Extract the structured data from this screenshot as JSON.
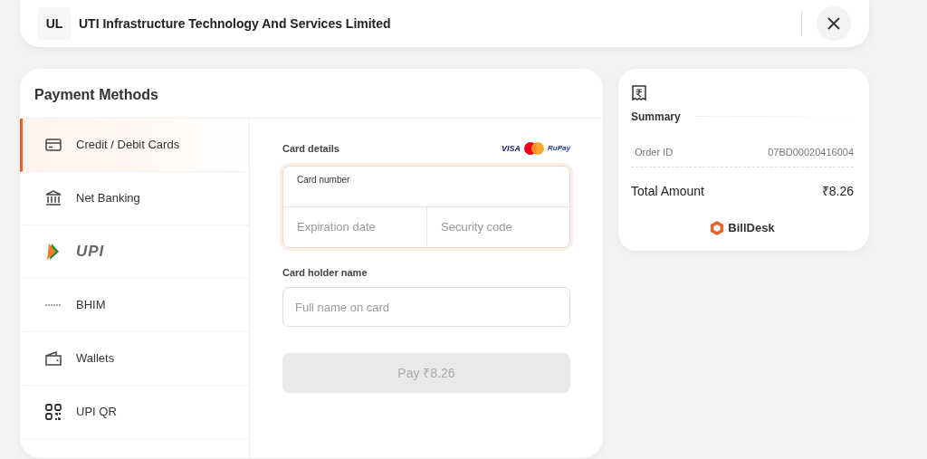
{
  "merchant": {
    "initials": "UL",
    "name": "UTI Infrastructure Technology And Services Limited"
  },
  "payment_methods": {
    "title": "Payment Methods",
    "items": [
      {
        "kind": "card",
        "label": "Credit / Debit Cards",
        "selected": true
      },
      {
        "kind": "bank",
        "label": "Net Banking",
        "selected": false
      },
      {
        "kind": "upi",
        "label": "UPI",
        "selected": false
      },
      {
        "kind": "bhim",
        "label": "BHIM",
        "selected": false
      },
      {
        "kind": "wallet",
        "label": "Wallets",
        "selected": false
      },
      {
        "kind": "qr",
        "label": "UPI QR",
        "selected": false
      }
    ]
  },
  "card_form": {
    "heading": "Card details",
    "brands": [
      "VISA",
      "RuPay"
    ],
    "card_number": {
      "label": "Card number"
    },
    "expiry": {
      "placeholder": "Expiration date"
    },
    "security_code": {
      "placeholder": "Security code"
    },
    "holder_label": "Card holder name",
    "holder": {
      "placeholder": "Full name on card"
    },
    "pay_button": {
      "label": "Pay ₹8.26",
      "disabled": true
    }
  },
  "summary": {
    "title": "Summary",
    "order_id_label": "Order ID",
    "order_id": "07BD00020416004",
    "total_label": "Total Amount",
    "total": "₹8.26",
    "brand": "BillDesk"
  }
}
